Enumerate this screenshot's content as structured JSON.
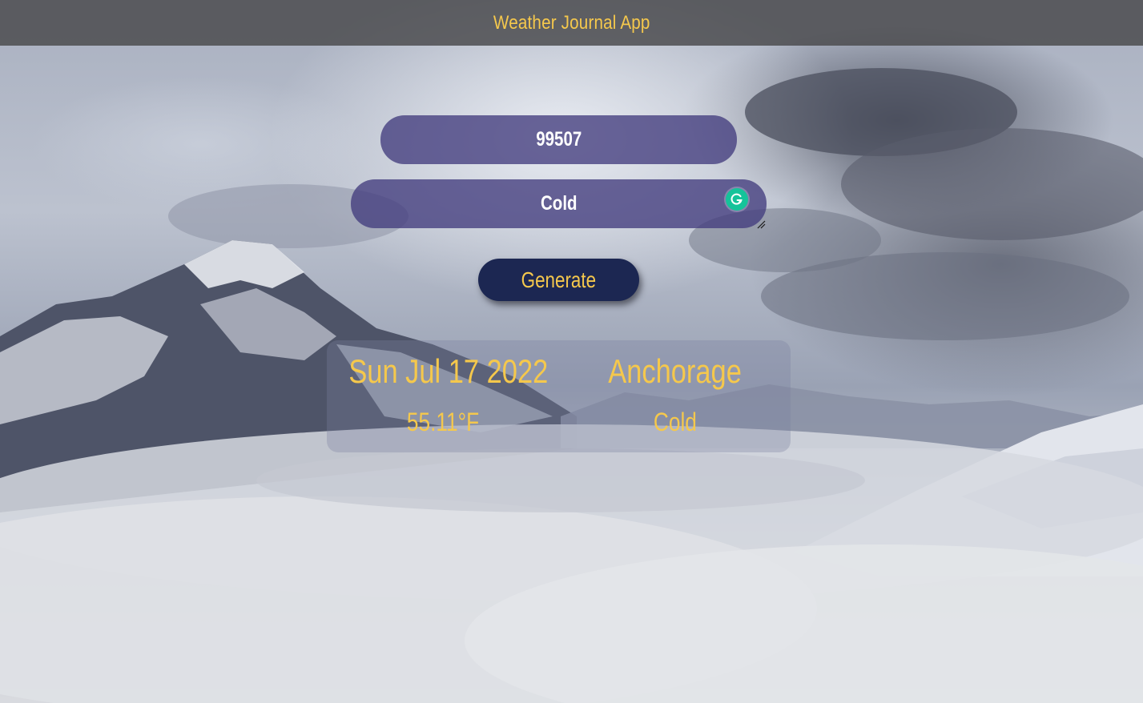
{
  "header": {
    "title": "Weather Journal App"
  },
  "form": {
    "zip_value": "99507",
    "feelings_value": "Cold",
    "generate_label": "Generate"
  },
  "result": {
    "date": "Sun Jul 17 2022",
    "city": "Anchorage",
    "temperature": "55.11°F",
    "content": "Cold"
  },
  "colors": {
    "accent": "#f5c84c",
    "input_background": "#423c7d",
    "button_background": "#1c2752",
    "header_background": "#48484a"
  },
  "icons": {
    "grammarly": "grammarly-icon",
    "resize": "resize-handle-icon"
  }
}
